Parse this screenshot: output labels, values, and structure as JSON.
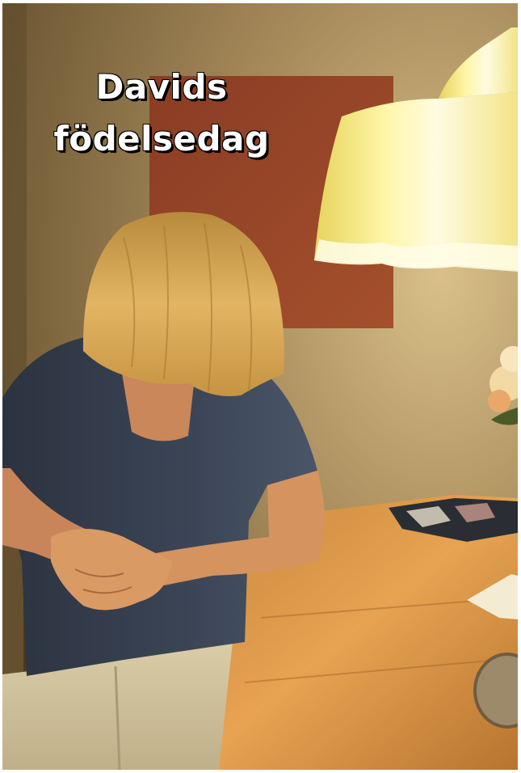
{
  "caption": {
    "line1": "Davids",
    "line2": "födelsedag"
  }
}
